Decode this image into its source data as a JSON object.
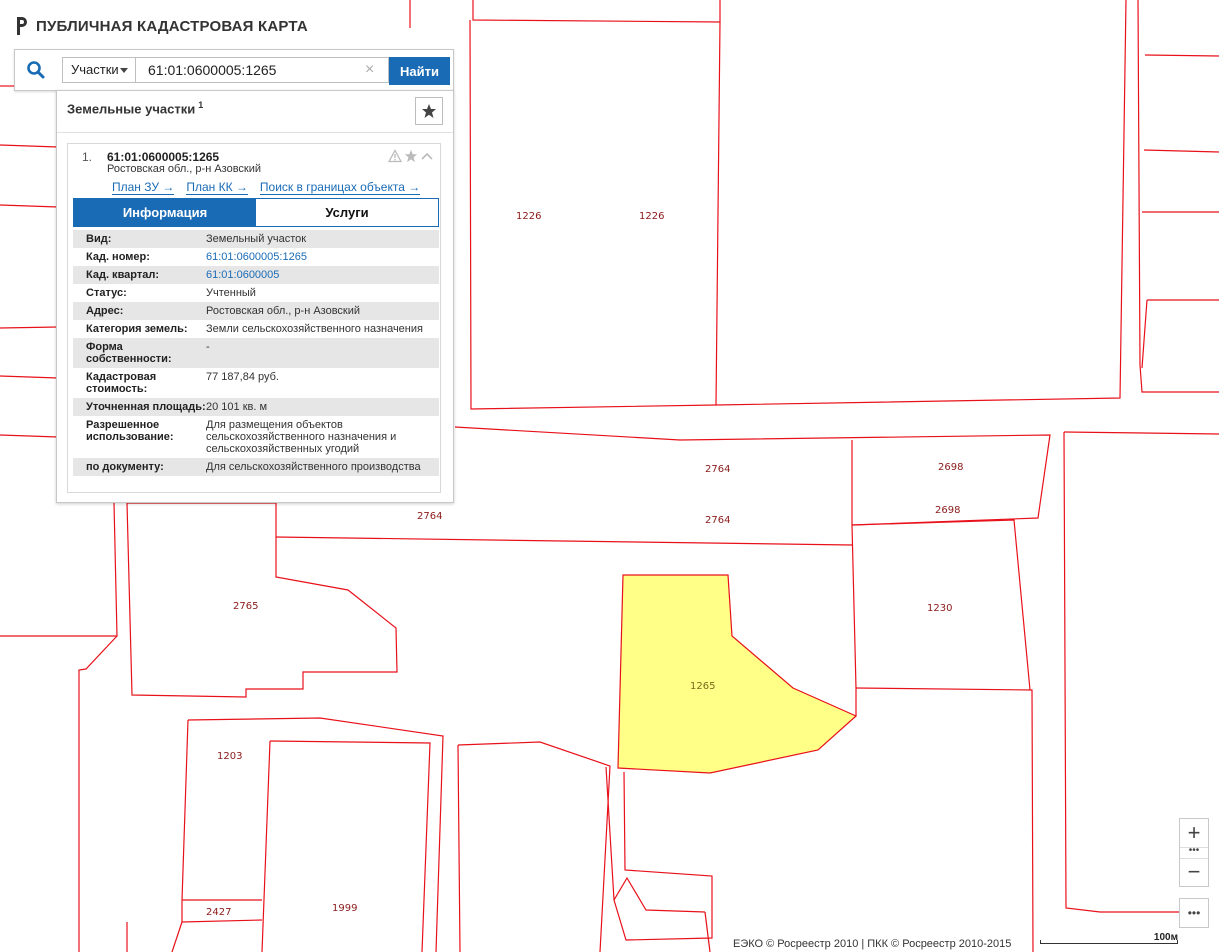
{
  "app": {
    "title": "ПУБЛИЧНАЯ КАДАСТРОВАЯ КАРТА"
  },
  "search": {
    "type_label": "Участки",
    "query": "61:01:0600005:1265",
    "find_label": "Найти",
    "clear_glyph": "×"
  },
  "results": {
    "heading": "Земельные участки",
    "count": "1",
    "item": {
      "index": "1.",
      "cad_number": "61:01:0600005:1265",
      "address": "Ростовская обл., р-н Азовский",
      "links": [
        "План ЗУ →",
        "План КК →",
        "Поиск в границах объекта →"
      ],
      "tabs": [
        "Информация",
        "Услуги"
      ],
      "properties": [
        {
          "key": "Вид:",
          "value": "Земельный участок"
        },
        {
          "key": "Кад. номер:",
          "value": "61:01:0600005:1265"
        },
        {
          "key": "Кад. квартал:",
          "value": "61:01:0600005"
        },
        {
          "key": "Статус:",
          "value": "Учтенный"
        },
        {
          "key": "Адрес:",
          "value": "Ростовская обл., р-н Азовский"
        },
        {
          "key": "Категория земель:",
          "value": "Земли сельскохозяйственного назначения"
        },
        {
          "key": "Форма собственности:",
          "value": "-"
        },
        {
          "key": "Кадастровая стоимость:",
          "value": "77 187,84 руб."
        },
        {
          "key": "Уточненная площадь:",
          "value": "20 101 кв. м"
        },
        {
          "key": "Разрешенное использование:",
          "value": "Для размещения объектов сельскохозяйственного назначения и сельскохозяйственных угодий"
        },
        {
          "key": "по документу:",
          "value": "Для сельскохозяйственного производства"
        }
      ]
    }
  },
  "map": {
    "parcel_labels": [
      "1226",
      "1226",
      "2764",
      "2764",
      "2764",
      "2698",
      "2698",
      "2765",
      "1230",
      "1265",
      "1203",
      "2427",
      "1999"
    ],
    "selected_parcel": "1265",
    "selected_fill": "#ffff88",
    "boundary_color": "#e8111a",
    "controls": {
      "zoom_in": "+",
      "zoom_out": "−",
      "dots": "•••"
    }
  },
  "footer": {
    "copyright": "ЕЭКО © Росреестр 2010 | ПКК © Росреестр 2010-2015",
    "scale": "100м"
  }
}
